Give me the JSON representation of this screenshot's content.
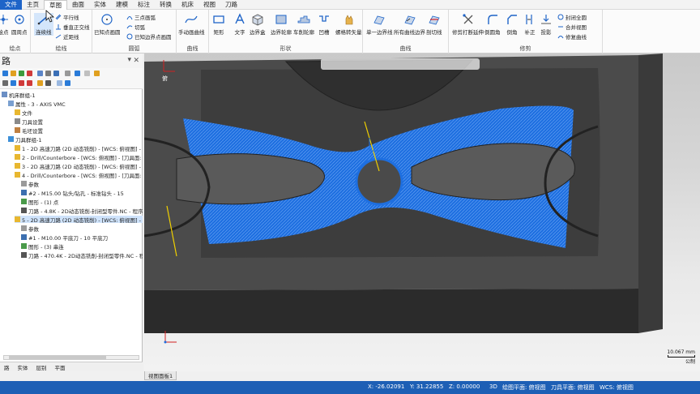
{
  "menubar": {
    "file_label": "文件",
    "tabs": [
      "主页",
      "草图",
      "曲面",
      "实体",
      "建模",
      "标注",
      "转换",
      "机床",
      "视图",
      "刀路"
    ],
    "active_tab": "草图"
  },
  "ribbon": {
    "groups": {
      "point": "绘点",
      "line": "绘线",
      "arc": "圆弧",
      "curve": "曲线",
      "shape": "形状",
      "spline": "曲线",
      "modify": "修剪"
    },
    "buttons": {
      "draw_point": "绘点",
      "circle_center": "圆周点",
      "connect_line": "连续线",
      "parallel_line": "平行线",
      "perpendicular_line": "垂直正交线",
      "near_line": "近距线",
      "circle_edge": "已知点画圆",
      "three_point_arc": "三点画弧",
      "tangent_arc": "切弧",
      "known_edge_circle": "已知边界点画圆",
      "manual_curve": "手动画曲线",
      "rectangle": "矩形",
      "text": "文字",
      "bounding_box": "边界盒",
      "boundary_profile": "边界轮廓",
      "lathe_profile": "车削轮廓",
      "groove": "凹槽",
      "rotate_vector": "螺格转矢量",
      "single_boundary": "单一边界线",
      "all_boundary": "所有曲线边界",
      "cut_line": "剖切线",
      "trim_break_extend": "修剪打断延伸",
      "fillet": "倒圆角",
      "chamfer": "倒角",
      "offset": "补正",
      "project": "投影",
      "close_all": "封闭全圆",
      "join_view": "合并视图",
      "repair_curve": "修复曲线"
    }
  },
  "left_panel": {
    "title": "路",
    "tree": [
      {
        "label": "机床群组-1",
        "depth": 0,
        "icon": "machine-group-icon"
      },
      {
        "label": "属性 - 3 - AXIS VMC",
        "depth": 1,
        "icon": "properties-icon"
      },
      {
        "label": "文件",
        "depth": 2,
        "icon": "folder-icon"
      },
      {
        "label": "刀具设置",
        "depth": 2,
        "icon": "tool-settings-icon"
      },
      {
        "label": "毛坯设置",
        "depth": 2,
        "icon": "stock-settings-icon"
      },
      {
        "label": "刀具群组-1",
        "depth": 1,
        "icon": "toolpath-group-icon"
      },
      {
        "label": "1 - 2D 高速刀路 (2D 动态铣削) - [WCS: 俯视图] - [",
        "depth": 2,
        "icon": "folder-icon"
      },
      {
        "label": "2 - Drill/Counterbore - [WCS: 俯视图] - [刀具面: 俯视",
        "depth": 2,
        "icon": "folder-icon"
      },
      {
        "label": "3 - 2D 高速刀路 (2D 动态铣削) - [WCS: 俯视图] - [",
        "depth": 2,
        "icon": "folder-icon"
      },
      {
        "label": "4 - Drill/Counterbore - [WCS: 俯视图] - [刀具面: 俯视",
        "depth": 2,
        "icon": "folder-icon"
      },
      {
        "label": "参数",
        "depth": 3,
        "icon": "parameters-icon"
      },
      {
        "label": "#2 - M15.00 钻头/钻孔 - 标准钻头 - 15",
        "depth": 3,
        "icon": "tool-icon"
      },
      {
        "label": "图形 - (1) 点",
        "depth": 3,
        "icon": "geometry-icon"
      },
      {
        "label": "刀路 - 4.8K - 2D动态铣削-封闭型零件.NC - 程序",
        "depth": 3,
        "icon": "toolpath-icon"
      },
      {
        "label": "5 - 2D 高速刀路 (2D 动态铣削) - [WCS: 俯视图] - [",
        "depth": 2,
        "icon": "folder-icon",
        "selected": true
      },
      {
        "label": "参数",
        "depth": 3,
        "icon": "parameters-icon"
      },
      {
        "label": "#1 - M10.00 平底刀 - 10 平底刀",
        "depth": 3,
        "icon": "tool-icon"
      },
      {
        "label": "图形 - (3) 串连",
        "depth": 3,
        "icon": "geometry-icon"
      },
      {
        "label": "刀路 - 470.4K - 2D动态铣削-封闭型零件.NC - 程",
        "depth": 3,
        "icon": "toolpath-icon"
      }
    ],
    "bottom_tabs": [
      "路",
      "实体",
      "层别",
      "平面"
    ]
  },
  "viewport": {
    "wcs_label": "俯",
    "scale_value": "10.067 mm",
    "scale_unit": "公制",
    "tab_label": "视图面板1",
    "toolpath_color": "#1e6fe0",
    "part_color": "#4a4a4a"
  },
  "statusbar": {
    "x": "X:  -26.02091",
    "y": "Y:  31.22855",
    "z": "Z:  0.00000",
    "mode": "3D",
    "drawing_plane": "绘图平面: 俯视图",
    "tool_plane": "刀具平面: 俯视图",
    "wcs": "WCS: 俯视图"
  }
}
